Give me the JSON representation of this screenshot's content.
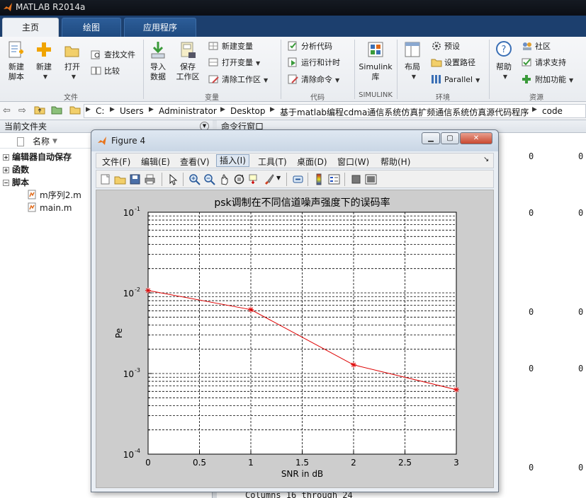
{
  "app": {
    "title": "MATLAB R2014a"
  },
  "tabs": [
    "主页",
    "绘图",
    "应用程序"
  ],
  "ribbon": {
    "new_script": [
      "新建",
      "脚本"
    ],
    "new": "新建",
    "open": "打开",
    "find_files": "查找文件",
    "compare": "比较",
    "file_group": "文件",
    "import_data": [
      "导入",
      "数据"
    ],
    "save_workspace": [
      "保存",
      "工作区"
    ],
    "new_variable": "新建变量",
    "open_variable": "打开变量",
    "clear_workspace": "清除工作区",
    "variable_group": "变量",
    "analyze_code": "分析代码",
    "run_and_time": "运行和计时",
    "clear_commands": "清除命令",
    "code_group": "代码",
    "simulink": [
      "Simulink",
      "库"
    ],
    "simulink_group": "SIMULINK",
    "layout": "布局",
    "preferences": "预设",
    "set_path": "设置路径",
    "parallel": "Parallel",
    "environment_group": "环境",
    "help": "帮助",
    "community": "社区",
    "request_support": "请求支持",
    "addons": "附加功能",
    "resources_group": "资源"
  },
  "address": {
    "crumbs": [
      "C:",
      "Users",
      "Administrator",
      "Desktop",
      "基于matlab编程cdma通信系统仿真扩频通信系统仿真源代码程序",
      "code"
    ]
  },
  "file_panel": {
    "title": "当前文件夹",
    "column_name": "名称",
    "sort_indicator": "▼",
    "items": [
      {
        "label": "编辑器自动保存",
        "expander": "+"
      },
      {
        "label": "函数",
        "expander": "+"
      },
      {
        "label": "脚本",
        "expander": "−"
      }
    ],
    "files": [
      "m序列2.m",
      "main.m"
    ]
  },
  "command_panel": {
    "title": "命令行窗口",
    "zero": "0",
    "columns_line": "Columns 16 through 24"
  },
  "figure": {
    "title": "Figure 4",
    "menus": [
      "文件(F)",
      "编辑(E)",
      "查看(V)",
      "插入(I)",
      "工具(T)",
      "桌面(D)",
      "窗口(W)",
      "帮助(H)"
    ],
    "active_menu": "插入(I)",
    "menu_arrow": "↘"
  },
  "chart_data": {
    "type": "line",
    "title": "psk调制在不同信道噪声强度下的误码率",
    "xlabel": "SNR in dB",
    "ylabel": "Pe",
    "x": [
      0,
      1,
      2,
      3
    ],
    "y": [
      0.0107,
      0.0062,
      0.00128,
      0.00063
    ],
    "xlim": [
      0,
      3
    ],
    "ylim": [
      0.0001,
      0.1
    ],
    "yscale": "log",
    "xticks": [
      "0",
      "0.5",
      "1",
      "1.5",
      "2",
      "2.5",
      "3"
    ],
    "yticks": [
      {
        "base": "10",
        "exp": "-1"
      },
      {
        "base": "10",
        "exp": "-2"
      },
      {
        "base": "10",
        "exp": "-3"
      },
      {
        "base": "10",
        "exp": "-4"
      }
    ],
    "grid": true,
    "line_color": "#dd0000",
    "marker": "*"
  }
}
